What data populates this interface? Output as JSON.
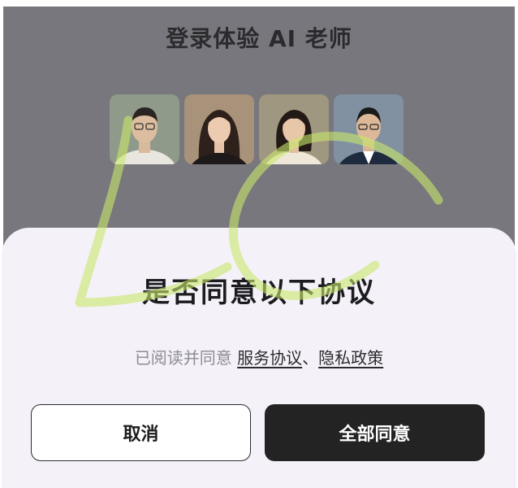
{
  "header": {
    "title": "登录体验 AI 老师"
  },
  "avatars": [
    {
      "name": "teacher-avatar-1",
      "bg": "#8f9a8a"
    },
    {
      "name": "teacher-avatar-2",
      "bg": "#a89279"
    },
    {
      "name": "teacher-avatar-3",
      "bg": "#9f977f"
    },
    {
      "name": "teacher-avatar-4",
      "bg": "#8191a2"
    }
  ],
  "dialog": {
    "title": "是否同意以下协议",
    "agree_prefix": "已阅读并同意 ",
    "link_service": "服务协议",
    "separator": "、",
    "link_privacy": "隐私政策",
    "cancel_label": "取消",
    "agree_label": "全部同意"
  },
  "colors": {
    "backdrop": "#78777d",
    "sheet": "#f5f1f9",
    "primary_button": "#232323",
    "watermark": "#c8e86a"
  }
}
